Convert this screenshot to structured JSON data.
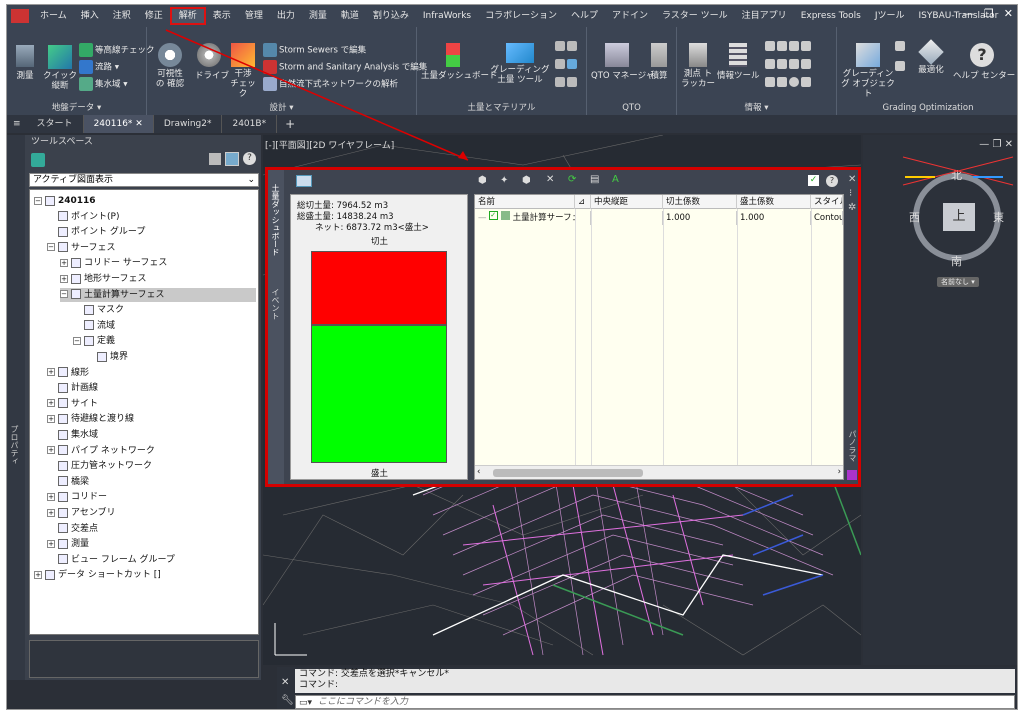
{
  "menu": {
    "items": [
      "ホーム",
      "挿入",
      "注釈",
      "修正",
      "解析",
      "表示",
      "管理",
      "出力",
      "測量",
      "軌道",
      "割り込み",
      "InfraWorks",
      "コラボレーション",
      "ヘルプ",
      "アドイン",
      "ラスター ツール",
      "注目アプリ",
      "Express Tools",
      "Jツール",
      "ISYBAU-Translator"
    ],
    "active_index": 4
  },
  "ribbon": {
    "ground_data": {
      "title": "地盤データ ▾",
      "survey": "測量",
      "quick_profile": "クイック 縦断",
      "contour_check": "等高線チェック",
      "flow": "流路 ▾",
      "catchment": "集水域 ▾"
    },
    "design": {
      "title": "設計 ▾",
      "visibility": "可視性の 確認",
      "drive": "ドライブ",
      "interference": "干渉 チェック",
      "storm_edit": "Storm Sewers で編集",
      "ssa_edit": "Storm and Sanitary Analysis で編集",
      "natural_flow": "自然流下式ネットワークの解析"
    },
    "earthwork": {
      "title": "土量とマテリアル",
      "dashboard": "土量ダッシュボード",
      "grading_tool": "グレーディング土量 ツール"
    },
    "qto": {
      "title": "QTO",
      "manager": "QTO マネージャ",
      "takeoff": "積算"
    },
    "info": {
      "title": "情報 ▾",
      "station_tracker": "測点 トラッカー",
      "info_tool": "情報ツール"
    },
    "grading_opt": {
      "title": "Grading Optimization",
      "grading_obj": "グレーディング オブジェクト",
      "optimize": "最適化",
      "help": "ヘルプ センター"
    }
  },
  "doctabs": [
    "スタート",
    "240116*",
    "Drawing2*",
    "2401B*"
  ],
  "toolspace": {
    "header": "ツールスペース",
    "dropdown": "アクティブ図面表示",
    "side_label": "プロパティ",
    "tree": [
      {
        "label": "240116",
        "level": 0,
        "expander": "⊟"
      },
      {
        "label": "ポイント(P)",
        "level": 1,
        "expander": ""
      },
      {
        "label": "ポイント グループ",
        "level": 1,
        "expander": ""
      },
      {
        "label": "サーフェス",
        "level": 1,
        "expander": "⊟"
      },
      {
        "label": "コリドー サーフェス",
        "level": 2,
        "expander": "⊞"
      },
      {
        "label": "地形サーフェス",
        "level": 2,
        "expander": "⊞"
      },
      {
        "label": "土量計算サーフェス",
        "level": 2,
        "expander": "⊟",
        "selected": true
      },
      {
        "label": "マスク",
        "level": 3,
        "expander": ""
      },
      {
        "label": "流域",
        "level": 3,
        "expander": ""
      },
      {
        "label": "定義",
        "level": 3,
        "expander": "⊟"
      },
      {
        "label": "境界",
        "level": 4,
        "expander": ""
      },
      {
        "label": "線形",
        "level": 1,
        "expander": "⊞"
      },
      {
        "label": "計画線",
        "level": 1,
        "expander": ""
      },
      {
        "label": "サイト",
        "level": 1,
        "expander": "⊞"
      },
      {
        "label": "待避線と渡り線",
        "level": 1,
        "expander": "⊞"
      },
      {
        "label": "集水域",
        "level": 1,
        "expander": ""
      },
      {
        "label": "パイプ ネットワーク",
        "level": 1,
        "expander": "⊞"
      },
      {
        "label": "圧力管ネットワーク",
        "level": 1,
        "expander": ""
      },
      {
        "label": "橋梁",
        "level": 1,
        "expander": ""
      },
      {
        "label": "コリドー",
        "level": 1,
        "expander": "⊞"
      },
      {
        "label": "アセンブリ",
        "level": 1,
        "expander": "⊞"
      },
      {
        "label": "交差点",
        "level": 1,
        "expander": ""
      },
      {
        "label": "測量",
        "level": 1,
        "expander": "⊞"
      },
      {
        "label": "ビュー フレーム グループ",
        "level": 1,
        "expander": ""
      },
      {
        "label": "データ ショートカット []",
        "level": 0,
        "expander": "⊞"
      }
    ]
  },
  "viewport": {
    "label": "[-][平面図][2D ワイヤフレーム]"
  },
  "viewcube": {
    "north": "北",
    "south": "南",
    "east": "東",
    "west": "西",
    "top": "上",
    "unnamed": "名前なし ▾"
  },
  "dashboard": {
    "side_tabs": [
      "土量ダッシュボード",
      "イベント"
    ],
    "right_tab": "パノラマ",
    "summary": {
      "cut": "総切土量: 7964.52 m3",
      "fill": "総盛土量: 14838.24 m3",
      "net": "ネット: 6873.72 m3<盛土>",
      "cut_label": "切土",
      "fill_label": "盛土"
    },
    "chart_ratio": {
      "cut": 7964.52,
      "fill": 14838.24
    },
    "columns": [
      "名前",
      "⊿",
      "中央縦距",
      "切土係数",
      "盛土係数",
      "スタイル"
    ],
    "rows": [
      {
        "name": "土量計算サーフェス",
        "c1": "",
        "c2": "",
        "cut_factor": "1.000",
        "fill_factor": "1.000",
        "style": "Contour"
      }
    ]
  },
  "command": {
    "history1": "コマンド: 交差点を選択*キャンセル*",
    "history2": "コマンド:",
    "placeholder": "ここにコマンドを入力"
  }
}
